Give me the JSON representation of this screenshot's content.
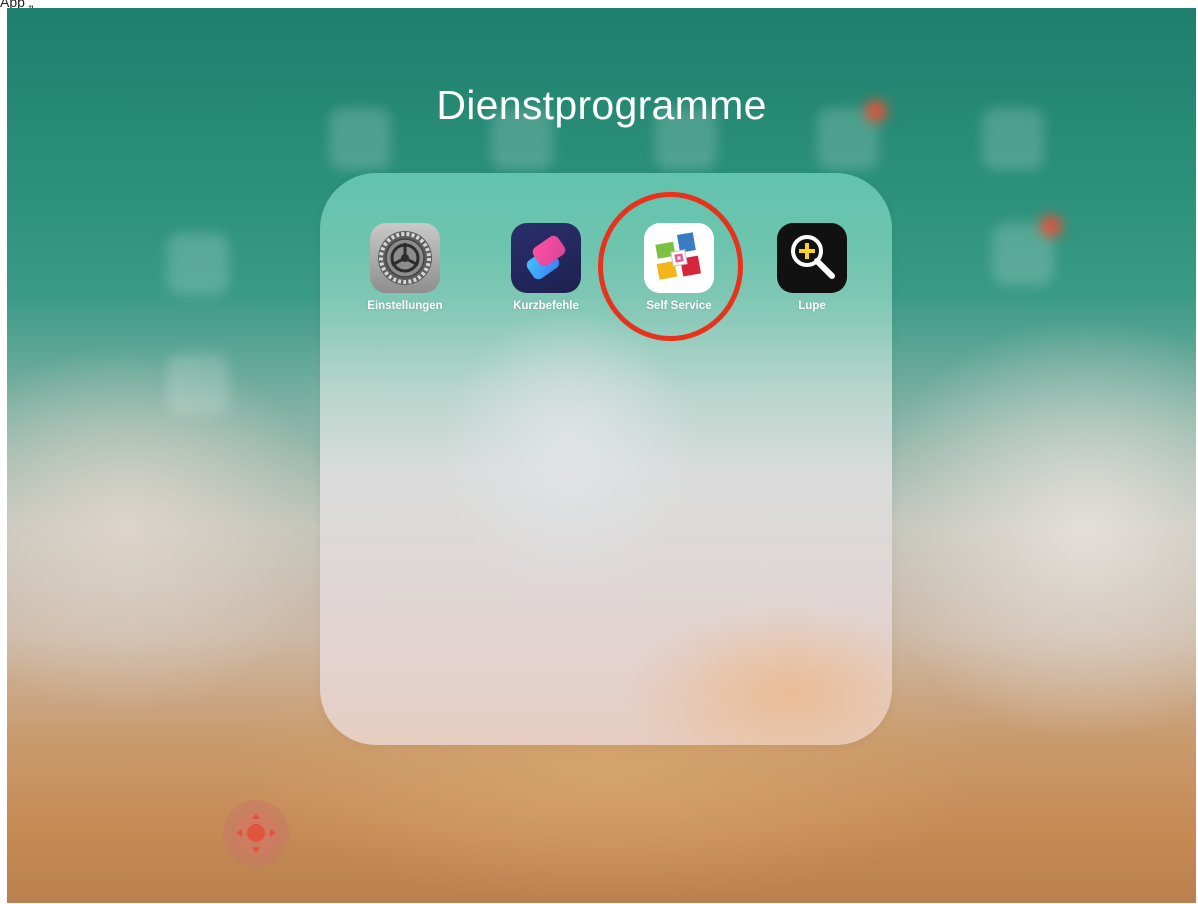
{
  "caption": "App „",
  "folder": {
    "title": "Dienstprogramme",
    "apps": [
      {
        "label": "Einstellungen",
        "icon": "settings-gear-icon"
      },
      {
        "label": "Kurzbefehle",
        "icon": "shortcuts-icon"
      },
      {
        "label": "Self Service",
        "icon": "self-service-icon",
        "highlighted": true
      },
      {
        "label": "Lupe",
        "icon": "magnifier-icon"
      }
    ]
  },
  "highlight_color": "#e8331c",
  "assistive_touch": {
    "icon": "assistive-touch-icon"
  }
}
